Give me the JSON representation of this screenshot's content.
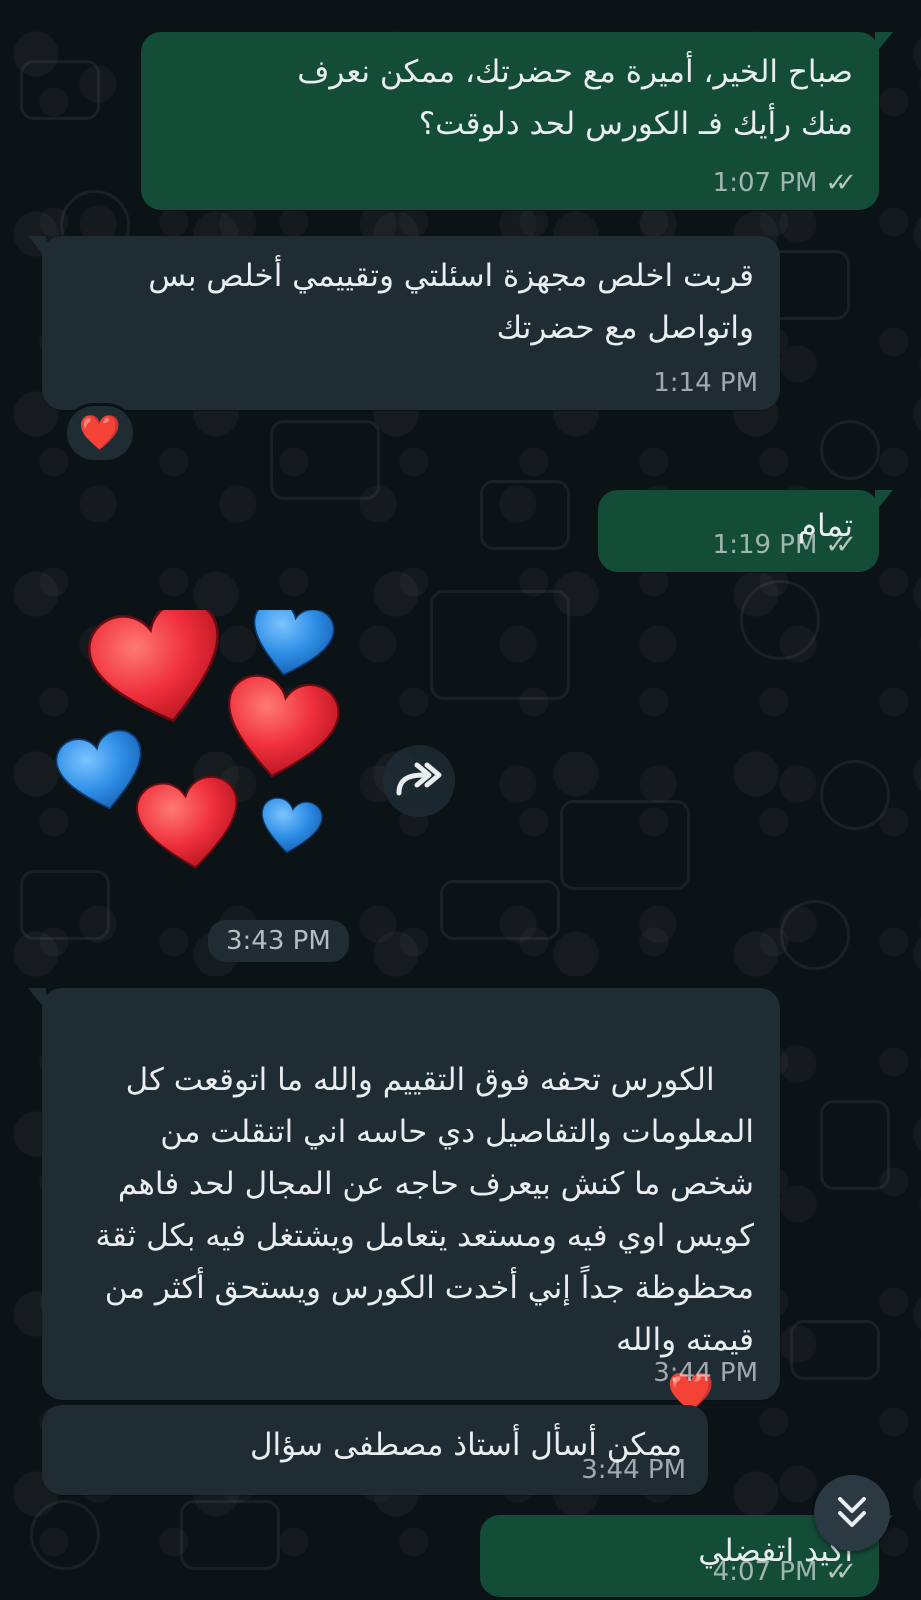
{
  "messages": [
    {
      "id": "m1",
      "direction": "outgoing",
      "text": "صباح الخير، أميرة مع حضرتك، ممكن نعرف منك رأيك فـ الكورس لحد دلوقت؟",
      "time": "1:07 PM",
      "status": "read"
    },
    {
      "id": "m2",
      "direction": "incoming",
      "text": "قربت اخلص مجهزة اسئلتي وتقييمي أخلص بس واتواصل مع حضرتك",
      "time": "1:14 PM",
      "reaction": "❤️"
    },
    {
      "id": "m3",
      "direction": "outgoing",
      "text": "تمام",
      "time": "1:19 PM",
      "status": "read"
    },
    {
      "id": "m4",
      "direction": "incoming",
      "type": "sticker",
      "sticker": "hearts-sticker",
      "time": "3:43 PM"
    },
    {
      "id": "m5",
      "direction": "incoming",
      "text": "الكورس تحفه فوق التقييم والله ما اتوقعت كل المعلومات والتفاصيل دي حاسه اني اتنقلت من شخص ما كنش بيعرف حاجه عن المجال لحد فاهم كويس اوي فيه ومستعد يتعامل ويشتغل فيه بكل ثقة محظوظة جداً إني أخدت الكورس ويستحق أكثر من قيمته والله",
      "emoji": "❤️",
      "time": "3:44 PM"
    },
    {
      "id": "m6",
      "direction": "incoming",
      "text": "ممكن أسأل أستاذ مصطفى سؤال",
      "time": "3:44 PM"
    },
    {
      "id": "m7",
      "direction": "outgoing",
      "text": "اكيد اتفضلي",
      "time": "4:07 PM",
      "status": "read"
    }
  ],
  "icons": {
    "read_ticks": "double-check-icon",
    "forward": "forward-icon",
    "scroll_down": "double-chevron-down-icon"
  },
  "colors": {
    "outgoing_bubble": "#144d37",
    "incoming_bubble": "#1f2c34",
    "background": "#0c1317",
    "heart_red": "#ef2f3c",
    "heart_blue": "#2f8fe6"
  }
}
